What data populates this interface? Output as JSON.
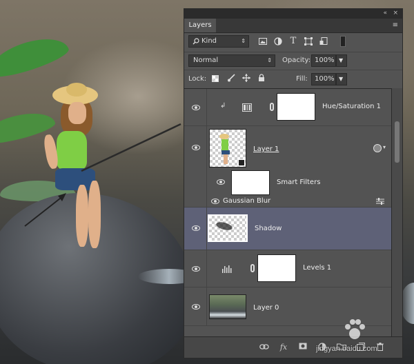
{
  "panel": {
    "tab_label": "Layers",
    "titlebar_icons": {
      "collapse": "«",
      "close": "×"
    },
    "menu_icon": "≡",
    "filter": {
      "kind_label": "Kind",
      "kind_icon": "search-icon"
    },
    "filter_icons": [
      "image-filter-icon",
      "adjustment-filter-icon",
      "type-filter-icon",
      "shape-filter-icon",
      "smart-object-filter-icon"
    ],
    "blend_mode": "Normal",
    "opacity_label": "Opacity:",
    "opacity_value": "100%",
    "lock_label": "Lock:",
    "fill_label": "Fill:",
    "fill_value": "100%",
    "layers": [
      {
        "name": "Hue/Saturation 1",
        "type": "adjustment"
      },
      {
        "name": "Layer 1",
        "type": "smart-object"
      },
      {
        "name": "Smart Filters",
        "type": "smart-filter-mask"
      },
      {
        "name": "Gaussian Blur",
        "type": "filter"
      },
      {
        "name": "Shadow",
        "type": "pixel",
        "selected": true
      },
      {
        "name": "Levels 1",
        "type": "adjustment"
      },
      {
        "name": "Layer 0",
        "type": "pixel"
      }
    ],
    "footer_icons": [
      "link-icon",
      "fx-icon",
      "mask-icon",
      "adjustment-icon",
      "group-icon",
      "new-layer-icon",
      "trash-icon"
    ],
    "fx_label": "fx"
  },
  "watermark": "jingyan.baidu.com",
  "colors": {
    "panel_bg": "#535353",
    "selected_row": "#5e6177",
    "dark_bar": "#2b2b2b"
  }
}
